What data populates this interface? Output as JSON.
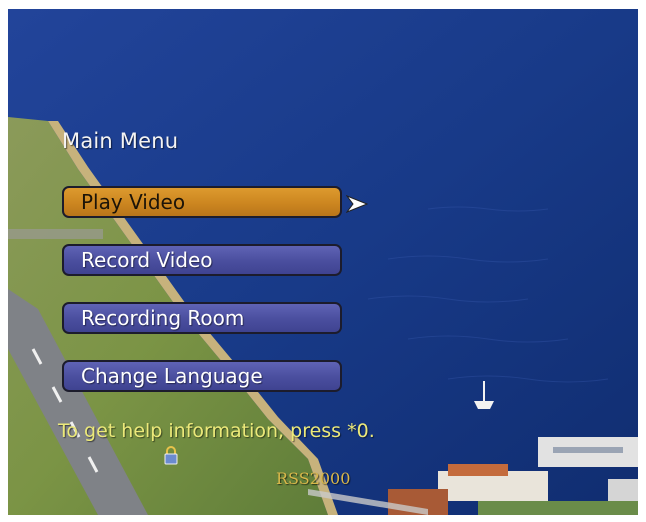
{
  "menu": {
    "title": "Main Menu",
    "items": [
      {
        "label": "Play Video",
        "selected": true
      },
      {
        "label": "Record Video",
        "selected": false
      },
      {
        "label": "Recording Room",
        "selected": false
      },
      {
        "label": "Change Language",
        "selected": false
      }
    ]
  },
  "help_text": "To get help information, press *0.",
  "brand": "RSS2000",
  "icons": {
    "selection": "chevron-right-icon",
    "lock": "lock-icon"
  },
  "colors": {
    "selected_button": "#cc8620",
    "button": "#4a4e9e",
    "help_text": "#ece97a",
    "brand_text": "#d8b74a"
  }
}
